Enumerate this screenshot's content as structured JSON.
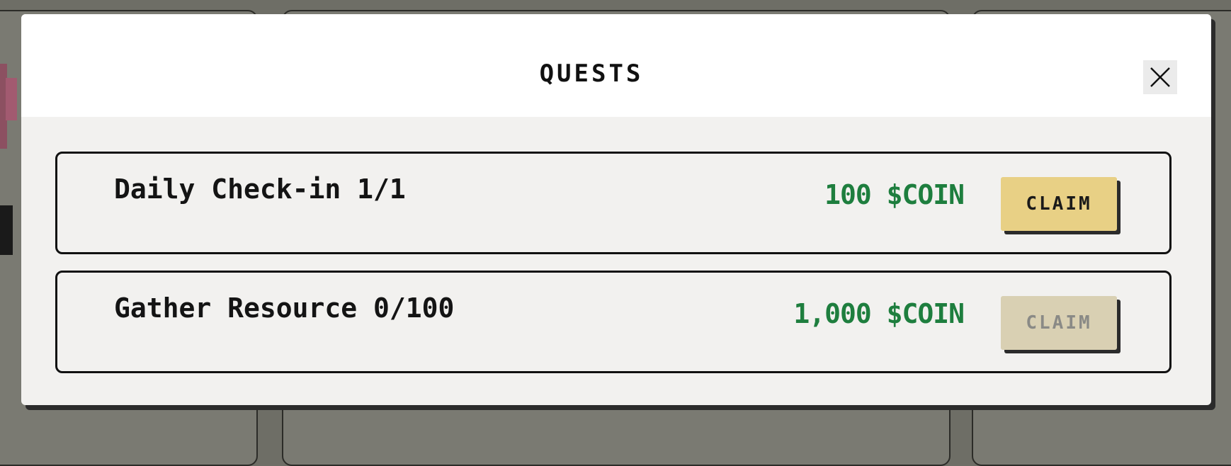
{
  "modal": {
    "title": "QUESTS",
    "close_icon": "close-icon"
  },
  "quests": [
    {
      "label": "Daily Check-in 1/1",
      "reward": "100 $COIN",
      "claim_label": "CLAIM",
      "claim_enabled": true
    },
    {
      "label": "Gather Resource 0/100",
      "reward": "1,000 $COIN",
      "claim_label": "CLAIM",
      "claim_enabled": false
    }
  ],
  "colors": {
    "reward_text": "#1e7e3e",
    "claim_enabled_bg": "#e8d085",
    "claim_disabled_bg": "#d9d0b3",
    "backdrop": "#6e6e66"
  }
}
